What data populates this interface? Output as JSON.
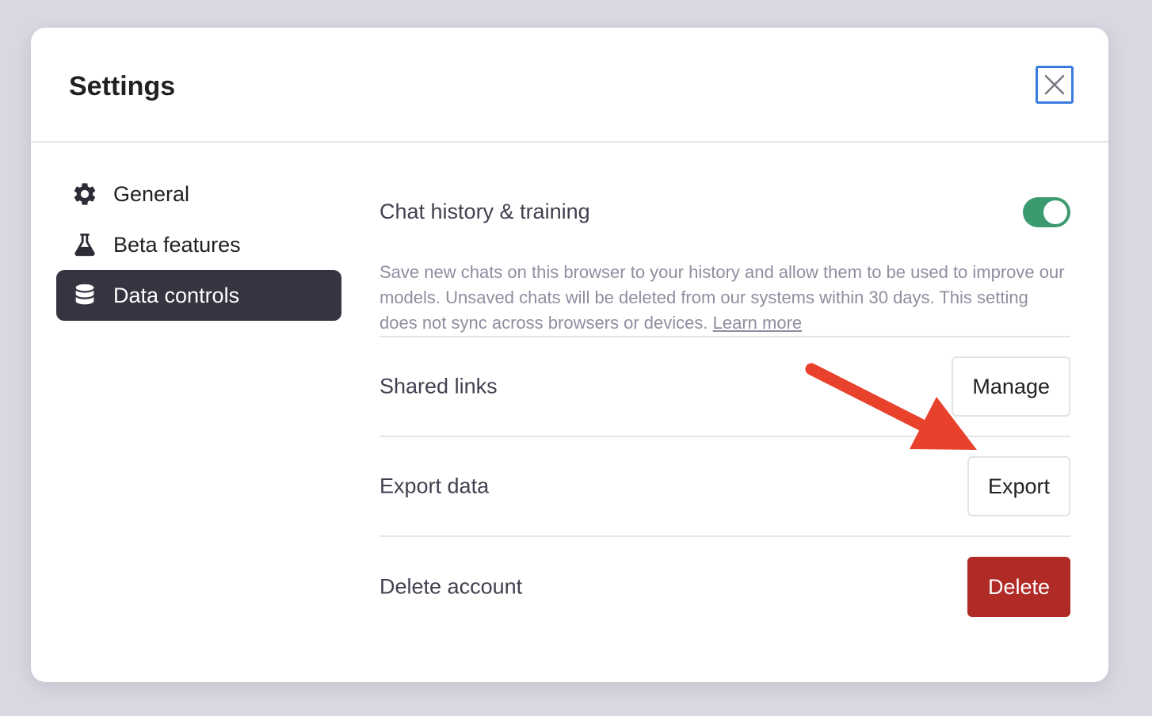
{
  "modal": {
    "title": "Settings"
  },
  "sidebar": {
    "items": [
      {
        "label": "General",
        "icon": "gear-icon",
        "active": false
      },
      {
        "label": "Beta features",
        "icon": "flask-icon",
        "active": false
      },
      {
        "label": "Data controls",
        "icon": "database-icon",
        "active": true
      }
    ]
  },
  "data_controls": {
    "history": {
      "label": "Chat history & training",
      "enabled": true,
      "description": "Save new chats on this browser to your history and allow them to be used to improve our models. Unsaved chats will be deleted from our systems within 30 days. This setting does not sync across browsers or devices.",
      "learn_more": "Learn more"
    },
    "shared_links": {
      "label": "Shared links",
      "button": "Manage"
    },
    "export_data": {
      "label": "Export data",
      "button": "Export"
    },
    "delete_account": {
      "label": "Delete account",
      "button": "Delete"
    }
  },
  "colors": {
    "toggle_on": "#3b9a6e",
    "danger": "#b02a26",
    "active_nav": "#343541",
    "annotation_arrow": "#e8412c",
    "focus_ring": "#3a7be0"
  }
}
